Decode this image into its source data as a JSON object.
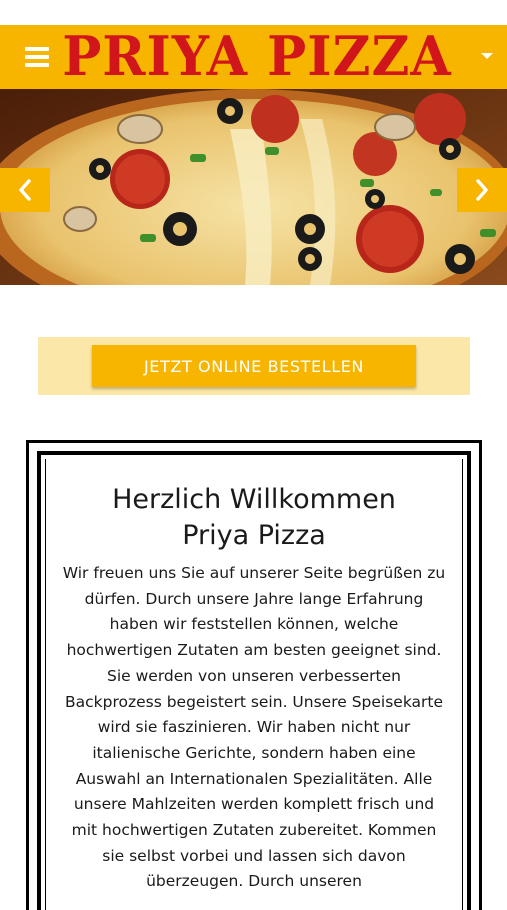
{
  "header": {
    "logo_text": "PRIYA PIZZA",
    "menu_icon": "hamburger-menu-icon",
    "dropdown_icon": "caret-down-icon",
    "bar_color": "#f7b500",
    "logo_color": "#d0151b"
  },
  "slider": {
    "image_subject": "pizza",
    "prev_icon": "chevron-left-icon",
    "next_icon": "chevron-right-icon"
  },
  "order": {
    "button_label": "JETZT ONLINE BESTELLEN"
  },
  "welcome": {
    "title_line1": "Herzlich Willkommen",
    "title_line2": "Priya Pizza",
    "text": "Wir freuen uns Sie auf unserer Seite begrüßen zu dürfen. Durch unsere Jahre lange Erfahrung haben wir feststellen können, welche hochwertigen Zutaten am besten geeignet sind. Sie werden von unseren verbesserten Backprozess begeistert sein. Unsere Speisekarte wird sie faszinieren. Wir haben nicht nur italienische Gerichte, sondern haben eine Auswahl an Internationalen Spezialitäten. Alle unsere Mahlzeiten werden komplett frisch und mit hochwertigen Zutaten zubereitet. Kommen sie selbst vorbei und lassen sich davon überzeugen. Durch unseren"
  }
}
